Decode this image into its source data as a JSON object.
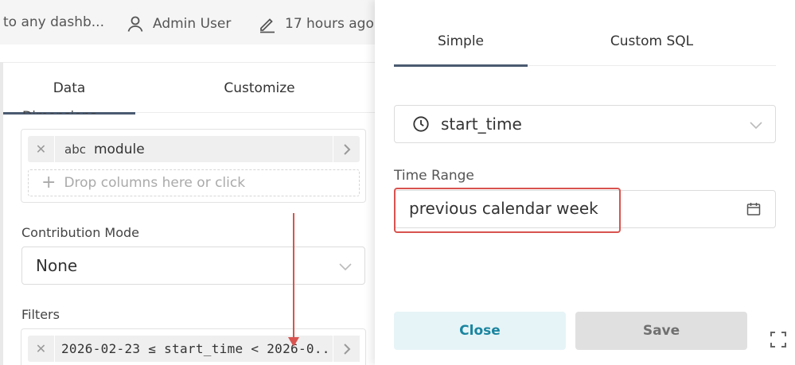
{
  "header": {
    "dashboards_text": "to any dashb...",
    "owner": "Admin User",
    "modified": "17 hours ago"
  },
  "editor": {
    "tabs": [
      "Data",
      "Customize"
    ],
    "dimensions_label": "Dimensions",
    "dimension_pill": {
      "type_label": "abc",
      "column": "module"
    },
    "dropzone_text": "Drop columns here or click",
    "contribution_label": "Contribution Mode",
    "contribution_value": "None",
    "filters_label": "Filters",
    "filter_pill": "2026-02-23 ≤ start_time < 2026-0..."
  },
  "popover": {
    "tabs": [
      "Simple",
      "Custom SQL"
    ],
    "column": "start_time",
    "time_range_label": "Time Range",
    "time_range_value": "previous calendar week",
    "close_label": "Close",
    "save_label": "Save"
  },
  "colors": {
    "accent_tab": "#4a5a70",
    "highlight": "#d9534f",
    "close_button_text": "#1a85a0",
    "close_button_bg": "#e6f4f7"
  }
}
